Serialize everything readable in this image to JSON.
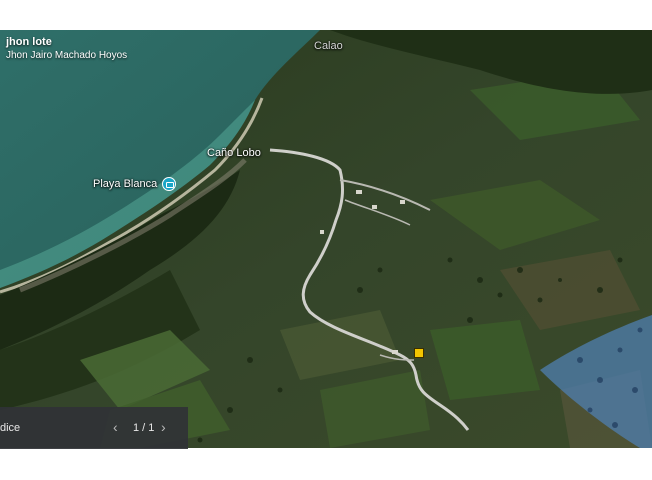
{
  "tour": {
    "title": "jhon lote",
    "author": "Jhon Jairo Machado Hoyos"
  },
  "places": {
    "calao": "Calao",
    "cano_lobo": "Caño Lobo",
    "playa_blanca": "Playa Blanca"
  },
  "icons": {
    "poi": "camera-icon",
    "pin": "location-marker-icon",
    "prev": "chevron-left-icon",
    "next": "chevron-right-icon"
  },
  "navigator": {
    "label": "dice",
    "prev_glyph": "‹",
    "count": "1 / 1",
    "next_glyph": "›"
  },
  "colors": {
    "sea": "#2e6e68",
    "land": "#2b3d1f",
    "road": "#c9c9c4",
    "lake": "#4f7fb0",
    "pin": "#f2c500",
    "poi": "#1aa6c7"
  }
}
